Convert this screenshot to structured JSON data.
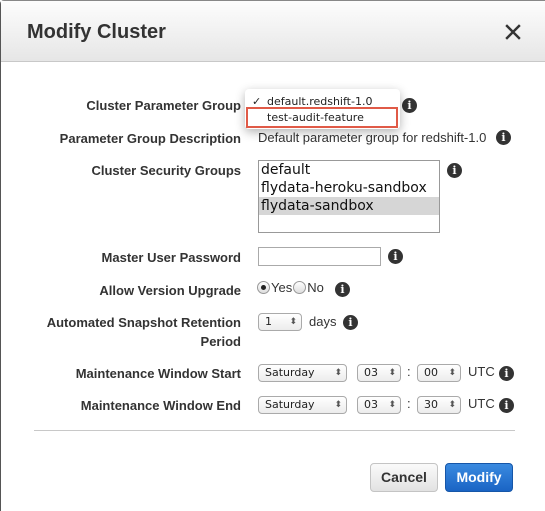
{
  "dialog": {
    "title": "Modify Cluster",
    "close_icon": "close-icon"
  },
  "form": {
    "parameter_group": {
      "label": "Cluster Parameter Group",
      "options": [
        {
          "label": "default.redshift-1.0",
          "checked": true
        },
        {
          "label": "test-audit-feature",
          "checked": false
        }
      ],
      "checkmark": "✓",
      "highlighted_option": "test-audit-feature"
    },
    "parameter_group_description": {
      "label": "Parameter Group Description",
      "value": "Default parameter group for redshift-1.0"
    },
    "security_groups": {
      "label": "Cluster Security Groups",
      "options": [
        "default",
        "flydata-heroku-sandbox",
        "flydata-sandbox"
      ],
      "selected": "flydata-sandbox"
    },
    "master_password": {
      "label": "Master User Password",
      "value": ""
    },
    "version_upgrade": {
      "label": "Allow Version Upgrade",
      "options": [
        "Yes",
        "No"
      ],
      "selected": "Yes"
    },
    "snapshot_retention": {
      "label_line1": "Automated Snapshot Retention",
      "label_line2": "Period",
      "value": "1",
      "unit": "days"
    },
    "maintenance_start": {
      "label": "Maintenance Window Start",
      "day": "Saturday",
      "hour": "03",
      "minute": "00",
      "separator": ":",
      "timezone": "UTC"
    },
    "maintenance_end": {
      "label": "Maintenance Window End",
      "day": "Saturday",
      "hour": "03",
      "minute": "30",
      "separator": ":",
      "timezone": "UTC"
    },
    "info_glyph": "i",
    "select_arrow": "⬍"
  },
  "footer": {
    "cancel_label": "Cancel",
    "modify_label": "Modify"
  },
  "colors": {
    "primary_button": "#1a64c4",
    "highlight_box": "#e05a47",
    "selected_list_item": "#d6d6d6"
  }
}
